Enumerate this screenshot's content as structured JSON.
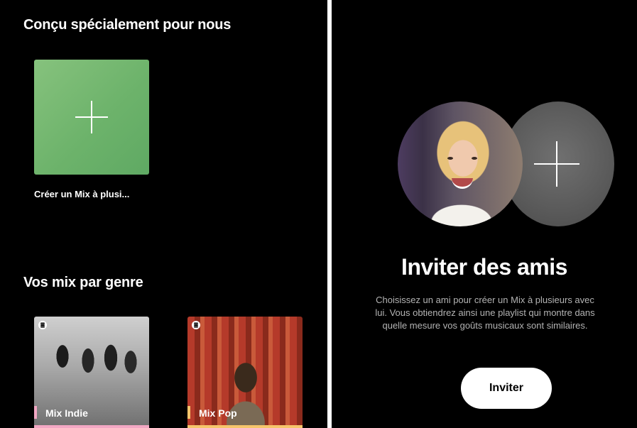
{
  "left": {
    "made_for_us_title": "Conçu spécialement pour nous",
    "create_mix_caption": "Créer un Mix à plusi...",
    "genre_section_title": "Vos mix par genre",
    "genre_cards": [
      {
        "label": "Mix Indie",
        "accent": "#f2a7c3"
      },
      {
        "label": "Mix Pop",
        "accent": "#f6c56b"
      }
    ]
  },
  "right": {
    "title": "Inviter des amis",
    "description": "Choisissez un ami pour créer un Mix à plusieurs avec lui. Vous obtiendrez ainsi une playlist qui montre dans quelle mesure vos goûts musicaux sont similaires.",
    "invite_button": "Inviter"
  },
  "colors": {
    "background": "#000000",
    "create_tile": "#74b871",
    "text_primary": "#ffffff",
    "text_secondary": "#b3b3b3"
  },
  "icons": {
    "plus": "plus-icon",
    "badge": "spotify-logo-icon"
  }
}
